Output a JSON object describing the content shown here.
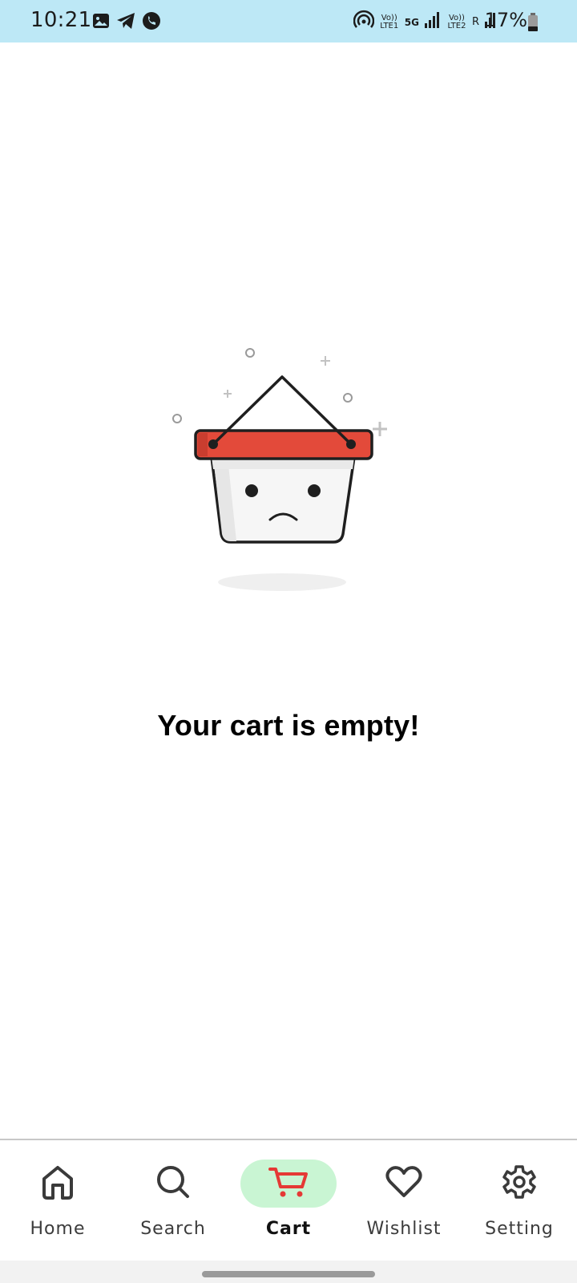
{
  "status_bar": {
    "time": "10:21",
    "network_1": "Vo)) LTE1",
    "network_gen": "5G",
    "network_2": "Vo)) LTE2",
    "roaming": "R",
    "battery": "17%",
    "icons": [
      "image-icon",
      "telegram-icon",
      "whatsapp-icon",
      "hotspot-icon",
      "signal-icon",
      "battery-icon"
    ]
  },
  "empty_state": {
    "title": "Your cart is empty!",
    "illustration": "sad-basket-illustration"
  },
  "bottom_nav": {
    "active": "Cart",
    "active_color": "#e53935",
    "active_pill_color": "#c9f5d3",
    "items": [
      {
        "label": "Home",
        "icon": "home-icon"
      },
      {
        "label": "Search",
        "icon": "search-icon"
      },
      {
        "label": "Cart",
        "icon": "cart-icon"
      },
      {
        "label": "Wishlist",
        "icon": "heart-icon"
      },
      {
        "label": "Setting",
        "icon": "gear-icon"
      }
    ]
  },
  "colors": {
    "status_bar_bg": "#bde8f6",
    "basket_rim": "#e34a3a"
  }
}
